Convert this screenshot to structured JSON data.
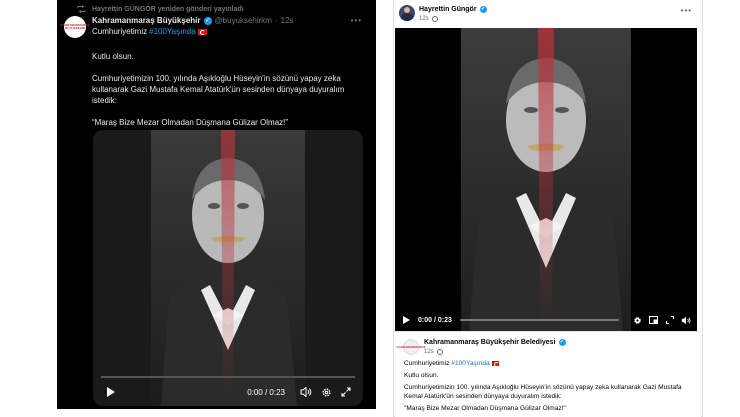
{
  "x_post": {
    "repost_label": "Hayrettin GÜNGÖR yeniden gönderi yayınladı",
    "avatar_text": "KAHRAMANMARAŞ BÜYÜKŞEHİR",
    "author_name": "Kahramanmaraş Büyükşehir",
    "handle": "@buyuksehirkm",
    "separator": "·",
    "time": "12s",
    "line1_prefix": "Cumhuriyetimiz",
    "line1_hashtag": "#100Yaşında",
    "para1": "Kutlu olsun.",
    "para2": "Cumhuriyetimizin 100. yılında Aşıkloğlu Hüseyin'in sözünü yapay zeka kullanarak Gazi Mustafa Kemal Atatürk'ün sesinden dünyaya duyuralım istedik:",
    "para3": "“Maraş Bize Mezar Olmadan Düşmana Gülizar Olmaz!”",
    "video_time": "0:00 / 0:23"
  },
  "fb_post": {
    "author_name": "Hayrettin Güngör",
    "time": "12s",
    "video_time": "0:00 / 0:23",
    "shared": {
      "avatar_text": "KAHRAMANMARAŞ",
      "author_name": "Kahramanmaraş Büyükşehir Belediyesi",
      "time": "12s",
      "line1_prefix": "Cumhuriyetimiz",
      "line1_hashtag": "#100Yaşında",
      "para1": "Kutlu olsun.",
      "para2": "Cumhuriyetimizin 100. yılında Aşıkloğlu Hüseyin'in sözünü yapay zeka kullanarak Gazi Mustafa Kemal Atatürk'ün sesinden dünyaya duyuralım istedik:",
      "para3": "\"Maraş Bize Mezar Olmadan Düşmana Gülizar Olmaz!\""
    }
  },
  "colors": {
    "x_background": "#000000",
    "x_link": "#1d9bf0",
    "fb_link": "#216fdb",
    "verified": "#1d9bf0",
    "flag_red": "#e30a17"
  },
  "icons": {
    "repost": "repost-icon",
    "verified": "verified-badge-icon",
    "more": "more-horizontal-icon",
    "play": "play-icon",
    "volume": "volume-icon",
    "settings": "gear-icon",
    "fullscreen": "fullscreen-icon",
    "globe": "globe-icon"
  }
}
